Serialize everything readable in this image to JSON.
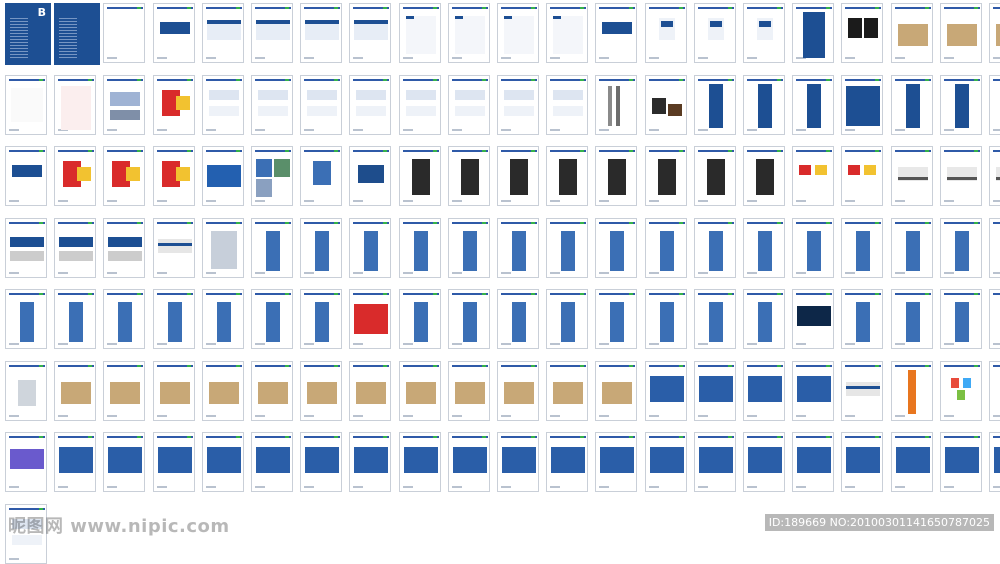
{
  "sheet": {
    "cover_letter": "B",
    "colors": {
      "brand_blue": "#1d4f93",
      "accent_green": "#35b24a",
      "kraft": "#c8a877",
      "red": "#d92b2b",
      "yellow": "#f2c230"
    },
    "rows": [
      [
        "cover",
        "cover",
        "blank",
        "card",
        "envelope",
        "envelope",
        "envelope",
        "envelope",
        "letter",
        "letter",
        "letter",
        "letter",
        "card",
        "badge",
        "badge",
        "badge",
        "folder",
        "dark",
        "kraft",
        "kraft",
        "kraft"
      ],
      [
        "diagram",
        "doc",
        "blue-card",
        "red",
        "stationery",
        "stationery",
        "stationery",
        "stationery",
        "stationery",
        "stationery",
        "stationery",
        "stationery",
        "pens",
        "bags",
        "flags",
        "flags",
        "flags",
        "blue",
        "flags",
        "flags",
        "flags"
      ],
      [
        "card",
        "red",
        "red",
        "red",
        "products",
        "pattern",
        "keychain",
        "logo",
        "uniform",
        "uniform",
        "uniform",
        "uniform",
        "uniform",
        "uniform",
        "uniform",
        "uniform",
        "caps",
        "caps",
        "van",
        "van",
        "van"
      ],
      [
        "truck",
        "truck",
        "truck",
        "bus",
        "building",
        "sign",
        "sign",
        "sign",
        "sign",
        "sign",
        "sign",
        "sign",
        "sign",
        "sign",
        "sign",
        "sign",
        "sign",
        "sign",
        "sign",
        "sign",
        "sign"
      ],
      [
        "sign",
        "sign",
        "sign",
        "sign",
        "sign",
        "sign",
        "sign",
        "grid",
        "sign",
        "sign",
        "sign",
        "sign",
        "sign",
        "sign",
        "sign",
        "sign",
        "billboard",
        "sign",
        "sign",
        "sign",
        "sign"
      ],
      [
        "trash",
        "boxes",
        "boxes",
        "boxes",
        "boxes",
        "boxes",
        "boxes",
        "boxes",
        "boxes",
        "boxes",
        "boxes",
        "boxes",
        "boxes",
        "board",
        "board",
        "board",
        "board",
        "bus",
        "banner",
        "balloons",
        "balloons"
      ],
      [
        "gradient",
        "board",
        "board",
        "board",
        "board",
        "board",
        "board",
        "board",
        "board",
        "board",
        "board",
        "board",
        "board",
        "board",
        "board",
        "board",
        "board",
        "board",
        "board",
        "board",
        "board"
      ],
      [
        "stationery"
      ]
    ]
  },
  "watermark": {
    "left_text": "昵图网 www.nipic.com",
    "right_text": "ID:189669 NO:20100301141650787025"
  }
}
